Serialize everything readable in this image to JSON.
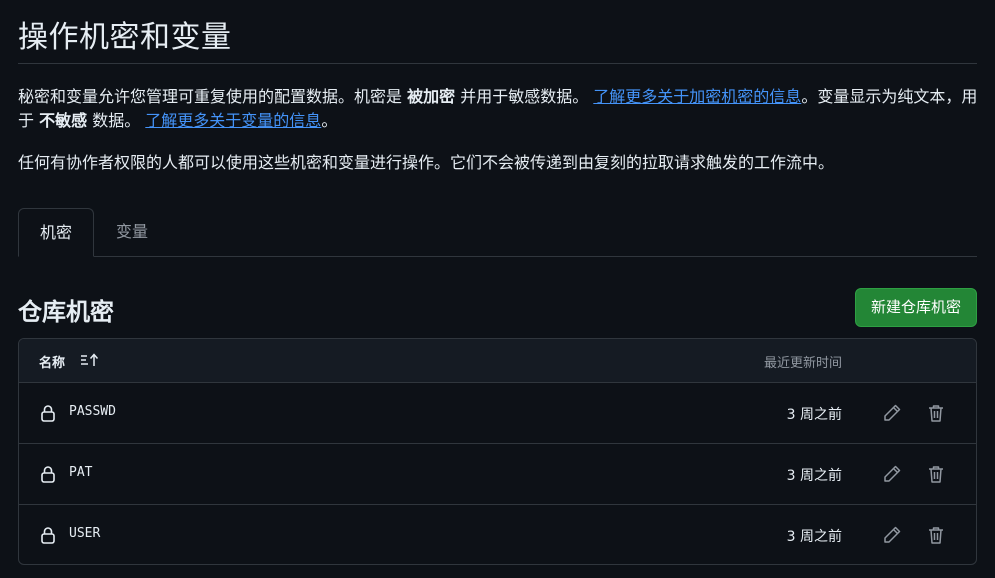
{
  "page_title": "操作机密和变量",
  "description": {
    "p1_a": "秘密和变量允许您管理可重复使用的配置数据。机密是 ",
    "p1_bold1": "被加密",
    "p1_b": " 并用于敏感数据。 ",
    "p1_link1": "了解更多关于加密机密的信息",
    "p1_c": "。变量显示为纯文本，用于 ",
    "p1_bold2": "不敏感",
    "p1_d": " 数据。 ",
    "p1_link2": "了解更多关于变量的信息",
    "p1_e": "。",
    "p2": "任何有协作者权限的人都可以使用这些机密和变量进行操作。它们不会被传递到由复刻的拉取请求触发的工作流中。"
  },
  "tabs": [
    {
      "label": "机密",
      "selected": true
    },
    {
      "label": "变量",
      "selected": false
    }
  ],
  "section": {
    "title": "仓库机密",
    "new_button": "新建仓库机密"
  },
  "table": {
    "col_name": "名称",
    "col_updated": "最近更新时间",
    "rows": [
      {
        "name": "PASSWD",
        "updated": "3 周之前"
      },
      {
        "name": "PAT",
        "updated": "3 周之前"
      },
      {
        "name": "USER",
        "updated": "3 周之前"
      }
    ]
  },
  "icons": {
    "sort": "sort-ascending-icon",
    "lock": "lock-icon",
    "edit": "pencil-icon",
    "delete": "trash-icon"
  },
  "colors": {
    "background": "#0d1117",
    "link": "#4493f8",
    "primary_button": "#238636",
    "border": "#30363d",
    "muted_text": "#9198a1"
  }
}
